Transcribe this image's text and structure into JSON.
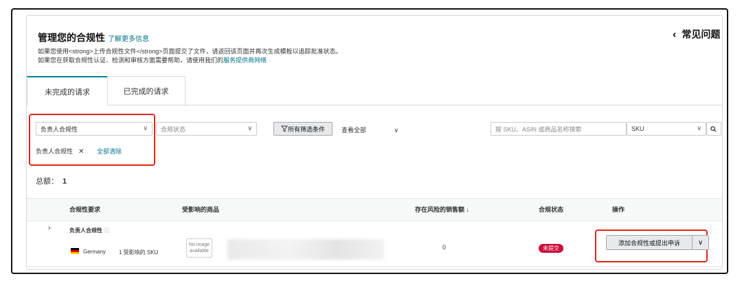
{
  "header": {
    "title": "管理您的合规性",
    "learn_more": "了解更多信息",
    "desc_line1": "如果您使用<strong>上传合规性文件</strong>页面提交了文件，请返回该页面并再次生成模板以追踪批准状态。",
    "desc_line2_prefix": "如果您在获取合规性认证、检测和审核方面需要帮助，请使用我们的",
    "desc_line2_link": "服务提供商网络",
    "faq": "常见问题"
  },
  "tabs": [
    {
      "label": "未完成的请求",
      "active": true
    },
    {
      "label": "已完成的请求",
      "active": false
    }
  ],
  "filters": {
    "responsible": {
      "value": "负责人合规性"
    },
    "status": {
      "placeholder": "合规状态"
    },
    "all_filters": "所有筛选条件",
    "view_all": "查看全部",
    "chip": "负责人合规性",
    "clear_all": "全部清除",
    "search": {
      "placeholder": "按 SKU、ASIN 或商品名称搜索"
    },
    "search_type": {
      "value": "SKU"
    }
  },
  "total": {
    "label": "总额：",
    "value": "1"
  },
  "table": {
    "headers": [
      "合规性要求",
      "受影响的商品",
      "存在风险的销售额",
      "合规状态",
      "操作"
    ],
    "rows": [
      {
        "requirement": "负责人合规性",
        "country": "Germany",
        "affected": "1 受影响的 SKU",
        "no_image": "No image available",
        "sales_at_risk": "0",
        "status": "未提交",
        "action": "添加合规性或提出申诉"
      }
    ]
  },
  "colors": {
    "accent": "#007185",
    "alert_red": "#e2231a",
    "badge_red": "#cc0c39"
  }
}
